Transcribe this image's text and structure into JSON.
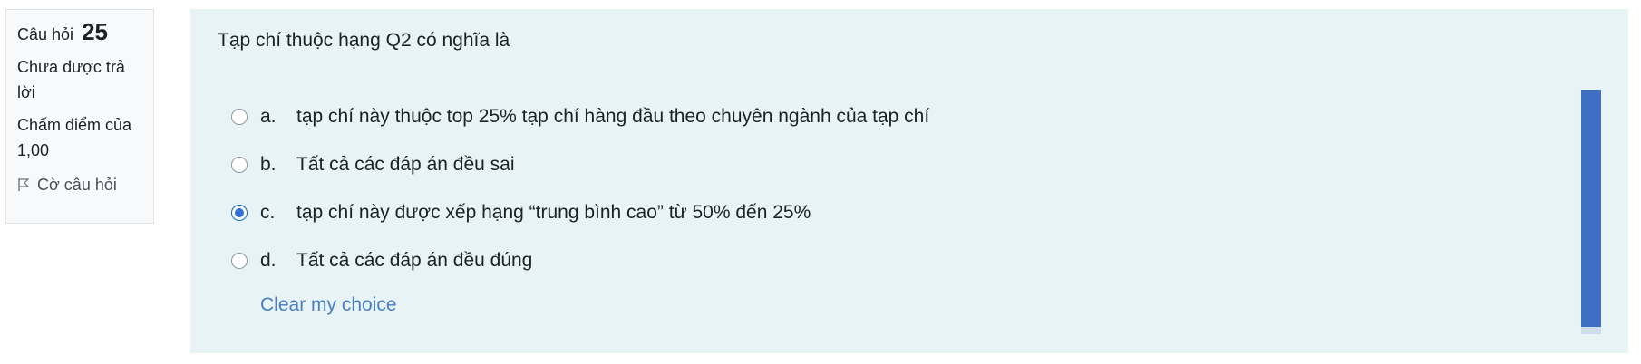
{
  "info": {
    "question_label": "Câu hỏi",
    "question_number": "25",
    "state_line1": "Chưa được trả",
    "state_line2": "lời",
    "grade_line1": "Chấm điểm của",
    "grade_line2": "1,00",
    "flag_label": "Cờ câu hỏi",
    "flag_icon": "flag-icon"
  },
  "question": {
    "text": "Tạp chí thuộc hạng Q2 có nghĩa là",
    "answers": [
      {
        "letter": "a.",
        "text": "tạp chí này thuộc top 25% tạp chí hàng đầu theo chuyên ngành của tạp chí",
        "selected": false
      },
      {
        "letter": "b.",
        "text": "Tất cả các đáp án đều sai",
        "selected": false
      },
      {
        "letter": "c.",
        "text": "tạp chí này được xếp hạng “trung bình cao” từ 50% đến 25%",
        "selected": true
      },
      {
        "letter": "d.",
        "text": "Tất cả các đáp án đều đúng",
        "selected": false
      }
    ],
    "clear_label": "Clear my choice"
  },
  "colors": {
    "panel_bg": "#e7f3f5",
    "accent_bar": "#3f6ec5",
    "link": "#4a7fc1"
  }
}
